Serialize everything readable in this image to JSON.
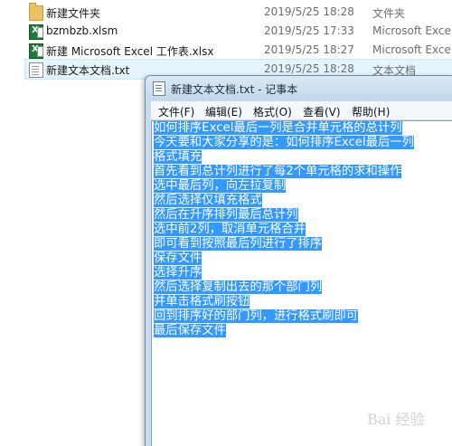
{
  "explorer": {
    "files": [
      {
        "name": "新建文件夹",
        "date": "2019/5/25 18:28",
        "type": "文件夹",
        "icon": "folder-icon"
      },
      {
        "name": "bzmbzb.xlsm",
        "date": "2019/5/25 17:33",
        "type": "Microsoft Exce",
        "icon": "excel-icon"
      },
      {
        "name": "新建 Microsoft Excel 工作表.xlsx",
        "date": "2019/5/25 18:27",
        "type": "Microsoft Exce",
        "icon": "excel-icon"
      },
      {
        "name": "新建文本文档.txt",
        "date": "2019/5/25 18:28",
        "type": "文本文档",
        "icon": "text-file-icon",
        "selected": true
      }
    ]
  },
  "notepad": {
    "title": "新建文本文档.txt - 记事本",
    "menu": [
      "文件(F)",
      "编辑(E)",
      "格式(O)",
      "查看(V)",
      "帮助(H)"
    ],
    "lines": [
      "如何排序Excel最后一列是合并单元格的总计列",
      "今天要和大家分享的是：如何排序Excel最后一列",
      "格式填充",
      "首先看到总计列进行了每2个单元格的求和操作",
      "选中最后列，向左拉复制",
      "然后选择仅填充格式",
      "然后在升序排列最后总计列",
      "选中前2列，取消单元格合并",
      "即可看到按照最后列进行了排序",
      "保存文件",
      "选择升序",
      "然后选择复制出去的那个部门列",
      "并单击格式刷按钮",
      "回到排序好的部门列，进行格式刷即可",
      "最后保存文件"
    ],
    "selection_color": "#3399ff"
  },
  "watermark": {
    "text": "Bai 经验"
  }
}
